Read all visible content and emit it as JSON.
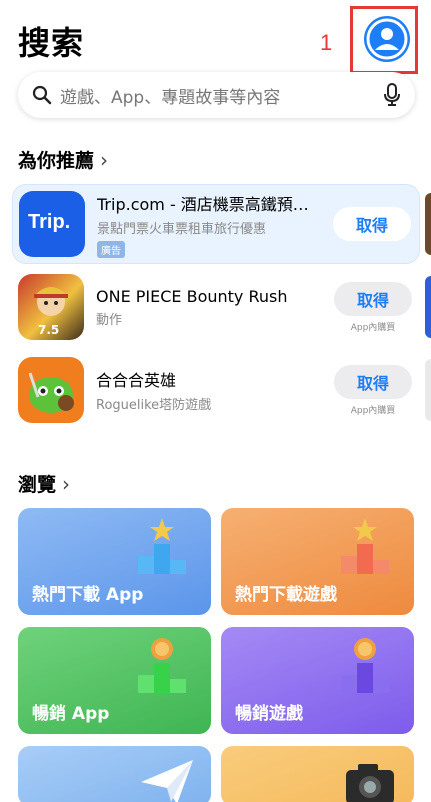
{
  "header": {
    "title": "搜索",
    "annotation_number": "1"
  },
  "search": {
    "placeholder": "遊戲、App、專題故事等內容"
  },
  "recommended": {
    "title": "為你推薦",
    "apps": [
      {
        "name": "Trip.com - 酒店機票高鐵預…",
        "subtitle": "景點門票火車票租車旅行優惠",
        "badge": "廣告",
        "button": "取得",
        "in_app": ""
      },
      {
        "name": "ONE PIECE Bounty Rush",
        "subtitle": "動作",
        "badge": "",
        "button": "取得",
        "in_app": "App內購買"
      },
      {
        "name": "合合合英雄",
        "subtitle": "Roguelike塔防遊戲",
        "badge": "",
        "button": "取得",
        "in_app": "App內購買"
      }
    ],
    "trip_icon_text": "Trip."
  },
  "browse": {
    "title": "瀏覽",
    "categories": [
      {
        "label": "熱門下載 App",
        "color": "#6ea4ee"
      },
      {
        "label": "熱門下載遊戲",
        "color": "#f29a55"
      },
      {
        "label": "暢銷 App",
        "color": "#55c465"
      },
      {
        "label": "暢銷遊戲",
        "color": "#8d6cf0"
      },
      {
        "label": "",
        "color": "#7fb2ee"
      },
      {
        "label": "",
        "color": "#f5b95c"
      }
    ]
  },
  "colors": {
    "accent": "#1e7ef7",
    "annotation": "#e53935"
  }
}
